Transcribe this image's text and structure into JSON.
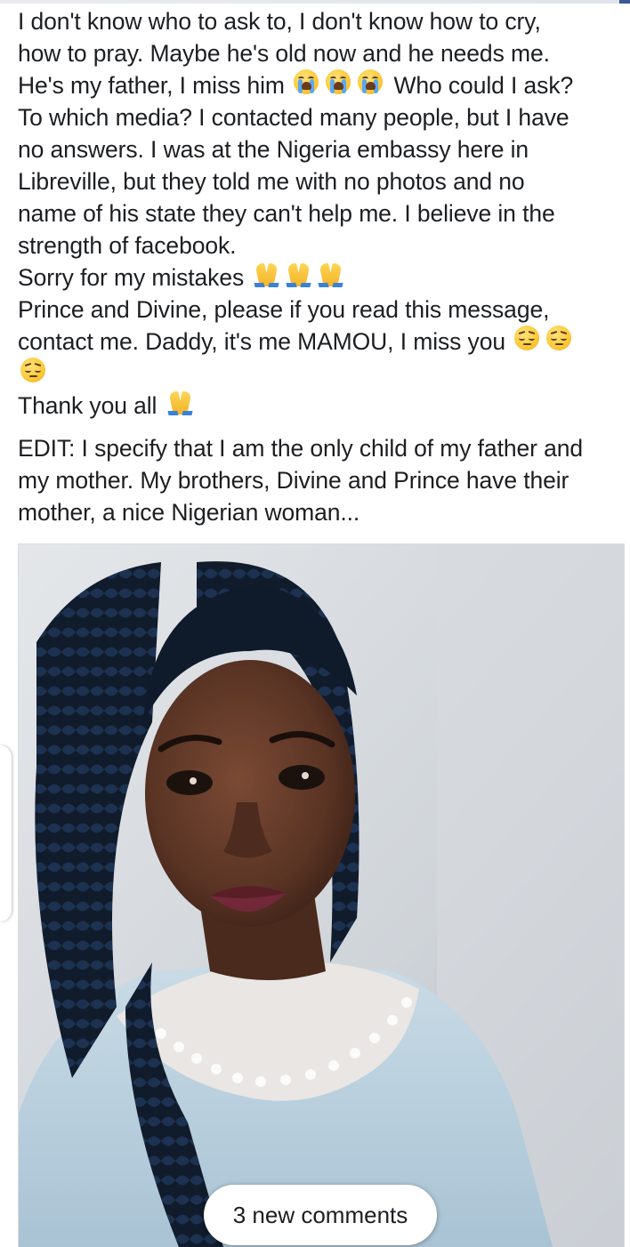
{
  "post": {
    "lines": [
      "I don't know who to ask to, I don't know how to cry,",
      "how to pray. Maybe he's old now and he needs me.",
      "He's my father, I miss him",
      "Who could I ask?",
      "To which media? I contacted many people, but I have",
      "no answers. I was at the Nigeria embassy here in",
      "Libreville, but they told me with no photos and no",
      "name of his state they can't help me. I believe in the",
      "strength of facebook.",
      "Sorry for my mistakes",
      "Prince and Divine, please if you read this message,",
      "contact me. Daddy, it's me MAMOU, I miss you",
      "Thank you all"
    ],
    "edit_lines": [
      "EDIT: I specify that I am the only child of my father and",
      "my mother. My brothers, Divine and Prince have their",
      "mother, a nice Nigerian woman..."
    ],
    "emoji": {
      "crying": "loudly-crying-face-icon",
      "praying": "folded-hands-icon",
      "pensive": "pensive-face-icon"
    }
  },
  "photo": {
    "alt": "selfie-photo"
  },
  "new_comments": {
    "label": "3 new comments"
  },
  "colors": {
    "text": "#1c1e21",
    "pill_bg": "#ffffff",
    "facebook_blue": "#3b5998"
  }
}
